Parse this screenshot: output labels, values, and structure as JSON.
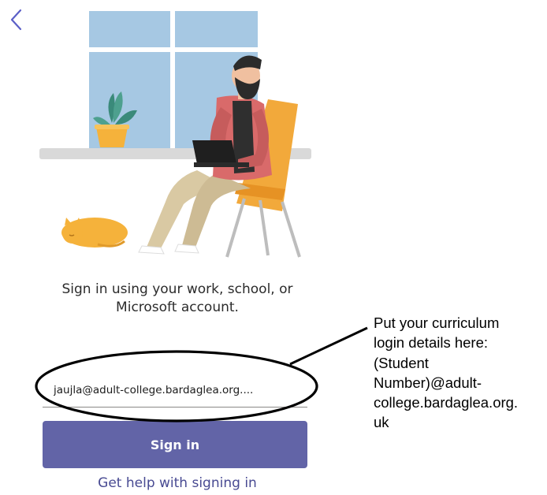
{
  "colors": {
    "accent": "#6264a7",
    "link": "#484a92",
    "annotation": "#000000"
  },
  "navigation": {
    "back_icon": "chevron-left-icon"
  },
  "illustration": {
    "icon": "person-with-laptop-illustration"
  },
  "signin": {
    "prompt_lines": [
      "Sign in using your work, school, or",
      "Microsoft account."
    ],
    "email_value": "jaujla@adult-college.bardaglea.org....",
    "button_label": "Sign in",
    "help_link": "Get help with signing in"
  },
  "annotation": {
    "lines": [
      "Put your curriculum",
      "login details here:",
      "(Student",
      "Number)@adult-",
      "college.bardaglea.org.",
      "uk"
    ]
  }
}
